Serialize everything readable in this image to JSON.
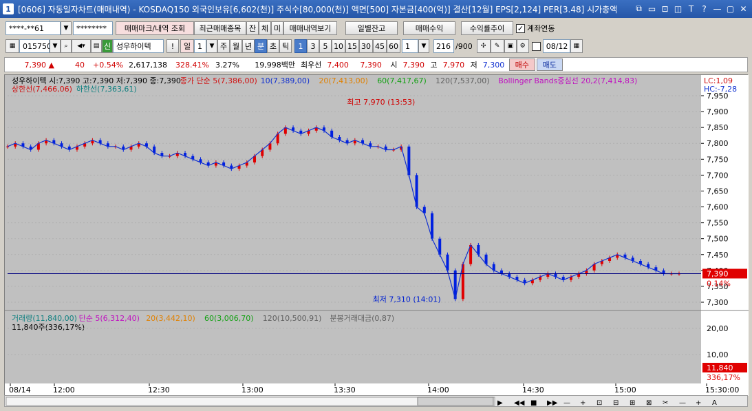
{
  "window": {
    "code": "1",
    "title": "[0606] 자동일자차트(매매내역) - KOSDAQ150 외국인보유[6,602(천)] 주식수[80,000(천)] 액면[500] 자본금[400(억)] 결산[12월] EPS[2,124] PER[3.48] 시가총액",
    "buttons": [
      "⧉",
      "▭",
      "⊡",
      "◫",
      "T",
      "?",
      "—",
      "▢",
      "✕"
    ]
  },
  "toolbar1": {
    "account": "****-**61",
    "password": "********",
    "btn_trade_mark": "매매마크/내역 조회",
    "btn_recent": "최근매매종목",
    "btn_jan": "잔",
    "btn_che": "체",
    "btn_mi": "미",
    "btn_trade_view": "매매내역보기",
    "btn_daily_balance": "일별잔고",
    "btn_trade_profit": "매매수익",
    "btn_return_trend": "수익률추이",
    "chk_account_link": "계좌연동"
  },
  "toolbar2": {
    "code": "015750",
    "credit": "신",
    "name": "성우하이텍",
    "periods": [
      "일",
      "주",
      "월",
      "년",
      "분",
      "초",
      "틱"
    ],
    "period_num": "1",
    "minutes": [
      "1",
      "3",
      "5",
      "10",
      "15",
      "30",
      "45",
      "60"
    ],
    "min_select": "1",
    "count": "216",
    "total": "/900",
    "date": "08/12"
  },
  "quote": {
    "price": "7,390",
    "change": "40",
    "rate": "+0.54%",
    "volume": "2,617,138",
    "vol_rate": "328.41%",
    "turnover": "3.27%",
    "amount": "19,998백만",
    "best_ask_label": "최우선",
    "best_ask": "7,400",
    "best_bid": "7,390",
    "open_label": "시",
    "open": "7,390",
    "high_label": "고",
    "high": "7,970",
    "low_label": "저",
    "low": "7,300",
    "buy": "매수",
    "sell": "매도"
  },
  "chart_data": {
    "type": "line",
    "legend_top": [
      {
        "text": "성우하이텍 시:7,390 고:7,390 저:7,390 종:7,390",
        "color": "#000000"
      },
      {
        "text": "종가 단순 5(7,386,00)",
        "color": "#d01010"
      },
      {
        "text": "10(7,389,00)",
        "color": "#1030d0"
      },
      {
        "text": "20(7,413,00)",
        "color": "#e08000"
      },
      {
        "text": "60(7,417,67)",
        "color": "#10a010"
      },
      {
        "text": "120(7,537,00)",
        "color": "#606060"
      },
      {
        "text": "Bollinger Bands중심선 20,2(7,414,83)",
        "color": "#c010c0"
      }
    ],
    "legend_top2": [
      {
        "text": "상한선(7,466,06)",
        "color": "#d01010"
      },
      {
        "text": "하한선(7,363,61)",
        "color": "#108080"
      }
    ],
    "lc_label": "LC:1,09",
    "hc_label": "HC:-7,28",
    "y_ticks": [
      "7,950",
      "7,900",
      "7,850",
      "7,800",
      "7,750",
      "7,700",
      "7,650",
      "7,600",
      "7,550",
      "7,500",
      "7,450",
      "7,400",
      "7,350",
      "7,300"
    ],
    "ylim": [
      7300,
      7950
    ],
    "price_tag": "7,390",
    "price_tag_pct": "0.14%",
    "max_label": "최고 7,970 (13:53)",
    "min_label": "최저 7,310 (14:01)",
    "vol_legend": [
      {
        "text": "거래량(11,840,00)",
        "color": "#108080"
      },
      {
        "text": "단순 5(6,312,40)",
        "color": "#c010c0"
      },
      {
        "text": "20(3,442,10)",
        "color": "#e08000"
      },
      {
        "text": "60(3,006,70)",
        "color": "#10a010"
      },
      {
        "text": "120(10,500,91)",
        "color": "#606060"
      },
      {
        "text": "분봉거래대금(0,87)",
        "color": "#606060"
      }
    ],
    "vol_label": "11,840주(336,17%)",
    "vol_y_ticks": [
      "20,00",
      "10,00"
    ],
    "vol_tag": "11,840",
    "vol_tag_pct": "336,17%",
    "x_ticks": [
      "08/14",
      "12:00",
      "12:30",
      "13:00",
      "13:30",
      "14:00",
      "14:30",
      "15:00",
      "15:30:00"
    ],
    "series": [
      {
        "values": [
          7790,
          7800,
          7790,
          7780,
          7800,
          7810,
          7800,
          7790,
          7780,
          7790,
          7800,
          7810,
          7800,
          7790,
          7790,
          7780,
          7790,
          7800,
          7790,
          7770,
          7760,
          7760,
          7770,
          7760,
          7750,
          7740,
          7730,
          7740,
          7730,
          7720,
          7730,
          7740,
          7760,
          7780,
          7800,
          7830,
          7850,
          7840,
          7830,
          7840,
          7850,
          7840,
          7820,
          7810,
          7800,
          7810,
          7800,
          7790,
          7790,
          7780,
          7780,
          7790,
          7700,
          7600,
          7580,
          7500,
          7450,
          7400,
          7310,
          7420,
          7480,
          7450,
          7420,
          7400,
          7390,
          7380,
          7370,
          7360,
          7370,
          7380,
          7390,
          7380,
          7370,
          7380,
          7390,
          7400,
          7420,
          7430,
          7440,
          7450,
          7440,
          7430,
          7420,
          7410,
          7400,
          7390,
          7390,
          7390
        ]
      }
    ]
  }
}
